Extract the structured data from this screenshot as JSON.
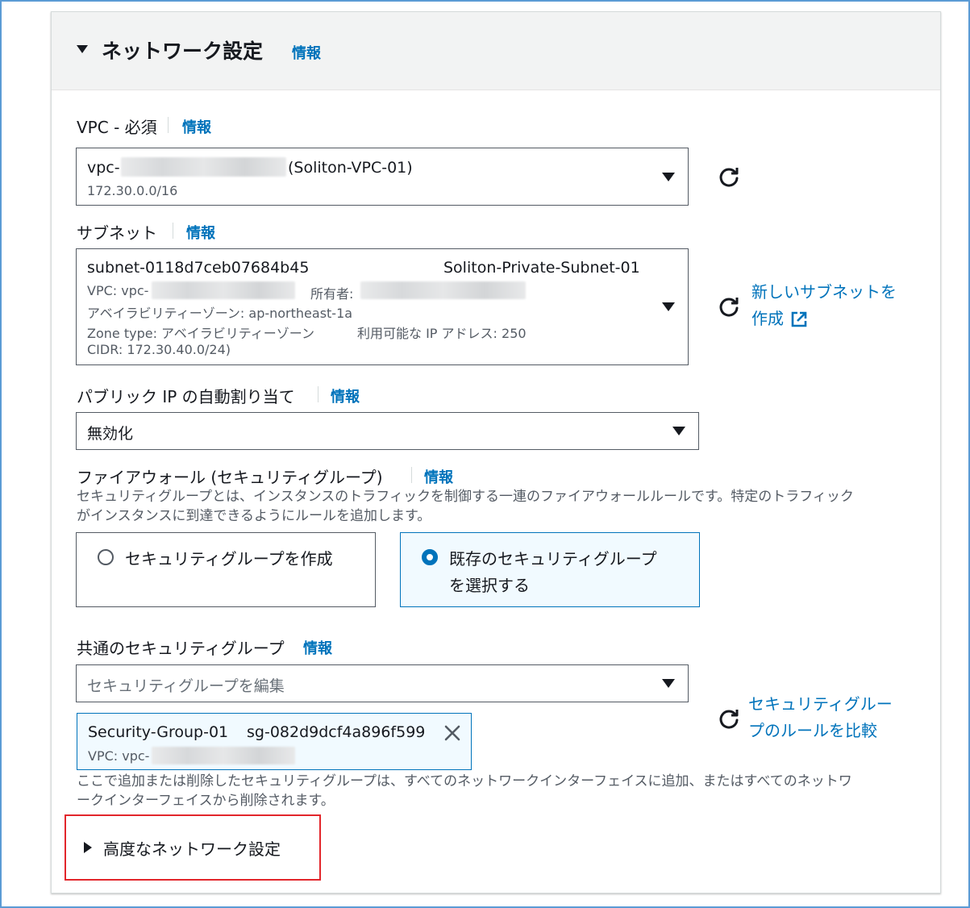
{
  "header": {
    "title": "ネットワーク設定",
    "info": "情報"
  },
  "vpc": {
    "label": "VPC - 必須",
    "info": "情報",
    "value_prefix": "vpc-",
    "value_name": "(Soliton-VPC-01)",
    "cidr": "172.30.0.0/16"
  },
  "subnet": {
    "label": "サブネット",
    "info": "情報",
    "id": "subnet-0118d7ceb07684b45",
    "name": "Soliton-Private-Subnet-01",
    "vpc_prefix": "VPC: vpc-",
    "owner_label": "所有者:",
    "az": "アベイラビリティーゾーン: ap-northeast-1a",
    "zone_type": "Zone type: アベイラビリティーゾーン",
    "available_ip": "利用可能な IP アドレス: 250",
    "cidr": "CIDR: 172.30.40.0/24)",
    "create_link_line1": "新しいサブネットを",
    "create_link_line2": "作成"
  },
  "public_ip": {
    "label": "パブリック IP の自動割り当て",
    "info": "情報",
    "value": "無効化"
  },
  "firewall": {
    "label": "ファイアウォール (セキュリティグループ)",
    "info": "情報",
    "description_line1": "セキュリティグループとは、インスタンスのトラフィックを制御する一連のファイアウォールルールです。特定のトラフィック",
    "description_line2": "がインスタンスに到達できるようにルールを追加します。",
    "option_create": "セキュリティグループを作成",
    "option_existing_line1": "既存のセキュリティグループ",
    "option_existing_line2": "を選択する",
    "selected": "existing"
  },
  "common_sg": {
    "label": "共通のセキュリティグループ",
    "info": "情報",
    "placeholder": "セキュリティグループを編集",
    "compare_link_line1": "セキュリティグルー",
    "compare_link_line2": "プのルールを比較",
    "token_name": "Security-Group-01",
    "token_id": "sg-082d9dcf4a896f599",
    "token_vpc_prefix": "VPC: vpc-",
    "note_line1": "ここで追加または削除したセキュリティグループは、すべてのネットワークインターフェイスに追加、またはすべてのネットワ",
    "note_line2": "ークインターフェイスから削除されます。"
  },
  "advanced": {
    "label": "高度なネットワーク設定"
  },
  "colors": {
    "link": "#0073bb",
    "selected_bg": "#f1faff",
    "highlight": "#e2262b"
  }
}
